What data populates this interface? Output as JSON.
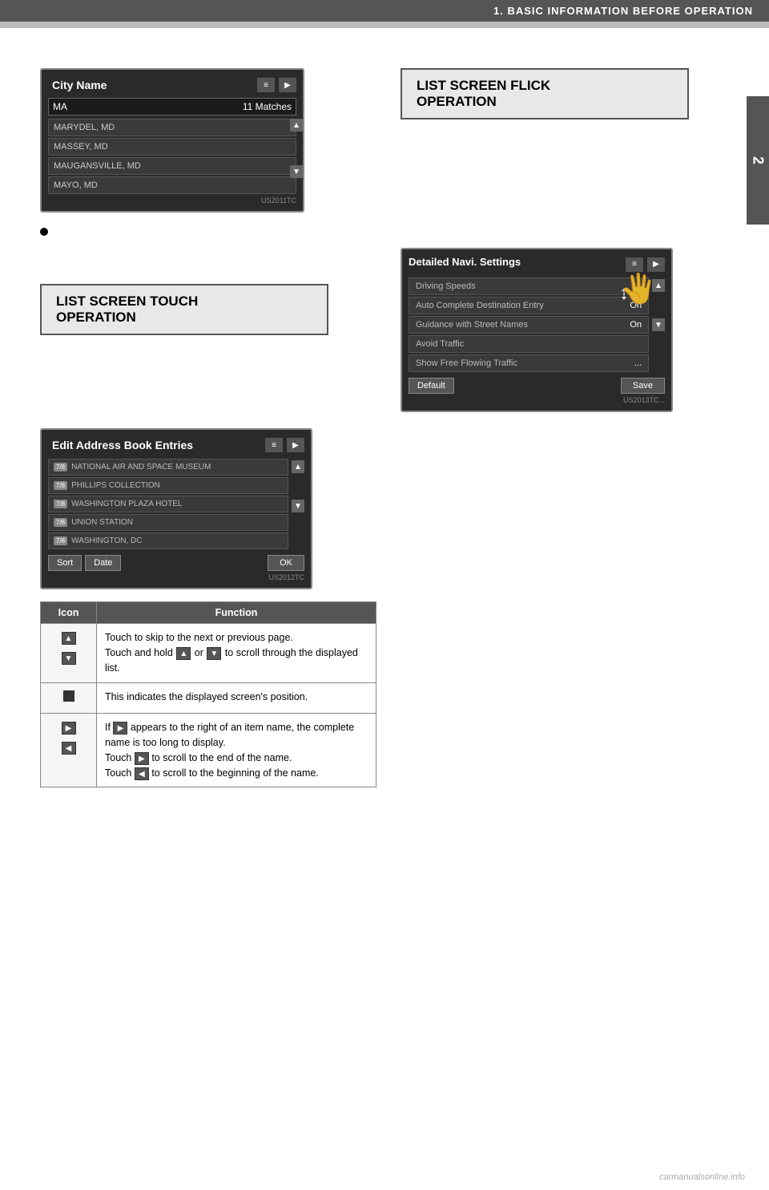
{
  "header": {
    "title": "1. BASIC INFORMATION BEFORE OPERATION"
  },
  "side_tab": {
    "number": "2"
  },
  "city_name_screen": {
    "title": "City Name",
    "search_text": "MA",
    "matches": "11 Matches",
    "items": [
      "MARYDEL, MD",
      "MASSEY, MD",
      "MAUGANSVILLE, MD",
      "MAYO, MD"
    ],
    "watermark": "US2011TC"
  },
  "address_book_screen": {
    "title": "Edit Address Book Entries",
    "items": [
      {
        "icon": "7/8",
        "name": "NATIONAL AIR AND SPACE MUSEUM"
      },
      {
        "icon": "7/8",
        "name": "PHILLIPS COLLECTION"
      },
      {
        "icon": "7/8",
        "name": "WASHINGTON PLAZA HOTEL"
      },
      {
        "icon": "7/8",
        "name": "UNION STATION"
      },
      {
        "icon": "7/8",
        "name": "WASHINGTON, DC"
      }
    ],
    "sort_btn": "Sort",
    "date_btn": "Date",
    "ok_btn": "OK",
    "watermark": "US2012TC"
  },
  "navi_settings_screen": {
    "title": "Detailed Navi. Settings",
    "items": [
      {
        "label": "Driving Speeds",
        "value": ""
      },
      {
        "label": "Auto Complete Destination Entry",
        "value": "On"
      },
      {
        "label": "Guidance with Street Names",
        "value": "On"
      },
      {
        "label": "Avoid Traffic",
        "value": ""
      },
      {
        "label": "Show Free Flowing Traffic",
        "value": "..."
      }
    ],
    "default_btn": "Default",
    "save_btn": "Save",
    "watermark": "US2013TC..."
  },
  "sections": {
    "list_screen_touch": {
      "heading_line1": "LIST SCREEN TOUCH",
      "heading_line2": "OPERATION"
    },
    "list_screen_flick": {
      "heading_line1": "LIST SCREEN FLICK",
      "heading_line2": "OPERATION"
    }
  },
  "table": {
    "col_icon": "Icon",
    "col_function": "Function",
    "rows": [
      {
        "icon_type": "scroll_btns",
        "function_text": "Touch to skip to the next or previous page.\nTouch and hold ▲ or ▼ to scroll through the displayed list."
      },
      {
        "icon_type": "position_indicator",
        "function_text": "This indicates the displayed screen's position."
      },
      {
        "icon_type": "arrow_btns",
        "function_text": "If ▶ appears to the right of an item name, the complete name is too long to display.\nTouch ▶ to scroll to the end of the name.\nTouch ◀ to scroll to the beginning of the name."
      }
    ]
  },
  "watermark": "carmanualsonline.info"
}
